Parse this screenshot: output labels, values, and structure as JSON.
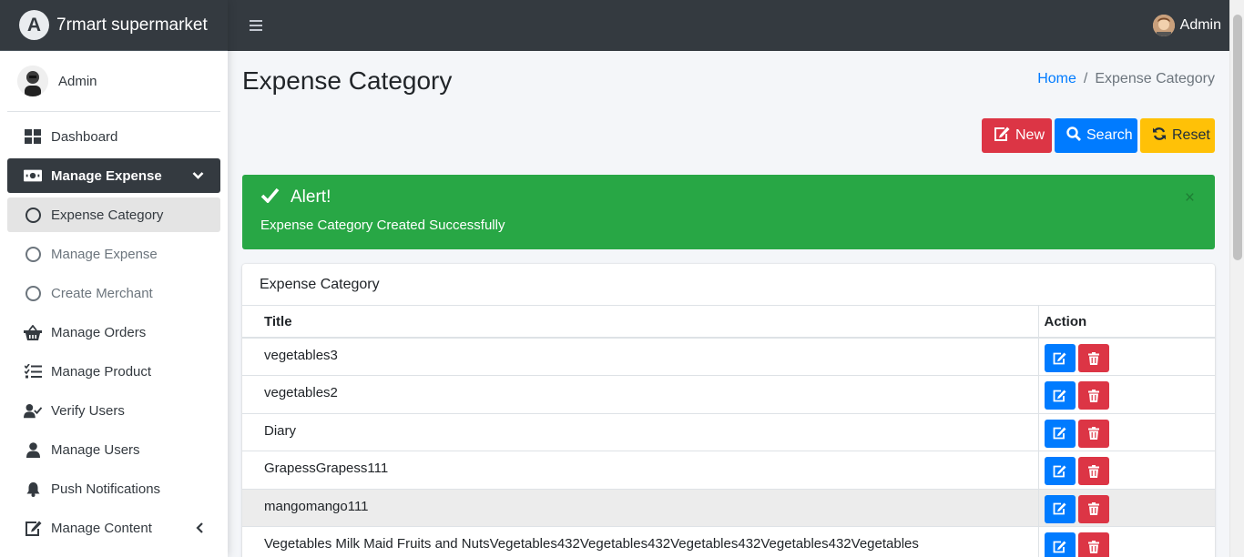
{
  "brand": {
    "name": "7rmart supermarket",
    "logo_letter": "A"
  },
  "topbar": {
    "user": "Admin"
  },
  "sidebar": {
    "user": "Admin",
    "items": [
      {
        "label": "Dashboard",
        "icon": "dashboard-icon"
      },
      {
        "label": "Manage Expense",
        "icon": "money-icon",
        "active": true
      },
      {
        "label": "Expense Category",
        "icon": "circle-icon",
        "selected": true
      },
      {
        "label": "Manage Expense",
        "icon": "circle-icon"
      },
      {
        "label": "Create Merchant",
        "icon": "circle-icon"
      },
      {
        "label": "Manage Orders",
        "icon": "basket-icon"
      },
      {
        "label": "Manage Product",
        "icon": "tasks-icon"
      },
      {
        "label": "Verify Users",
        "icon": "user-check-icon"
      },
      {
        "label": "Manage Users",
        "icon": "user-icon"
      },
      {
        "label": "Push Notifications",
        "icon": "bell-icon"
      },
      {
        "label": "Manage Content",
        "icon": "edit-icon"
      }
    ]
  },
  "page": {
    "title": "Expense Category"
  },
  "breadcrumb": {
    "home": "Home",
    "separator": "/",
    "current": "Expense Category"
  },
  "buttons": {
    "new": "New",
    "search": "Search",
    "reset": "Reset"
  },
  "alert": {
    "title": "Alert!",
    "message": "Expense Category Created Successfully",
    "close": "×"
  },
  "table": {
    "card_title": "Expense Category",
    "columns": [
      "Title",
      "Action"
    ],
    "rows": [
      "vegetables3",
      "vegetables2",
      "Diary",
      "GrapessGrapess111",
      "mangomango111",
      "Vegetables Milk Maid Fruits and NutsVegetables432Vegetables432Vegetables432Vegetables432Vegetables"
    ]
  },
  "colors": {
    "primary": "#007bff",
    "danger": "#dc3545",
    "warning": "#ffc107",
    "success": "#28a745",
    "dark": "#343a40"
  }
}
